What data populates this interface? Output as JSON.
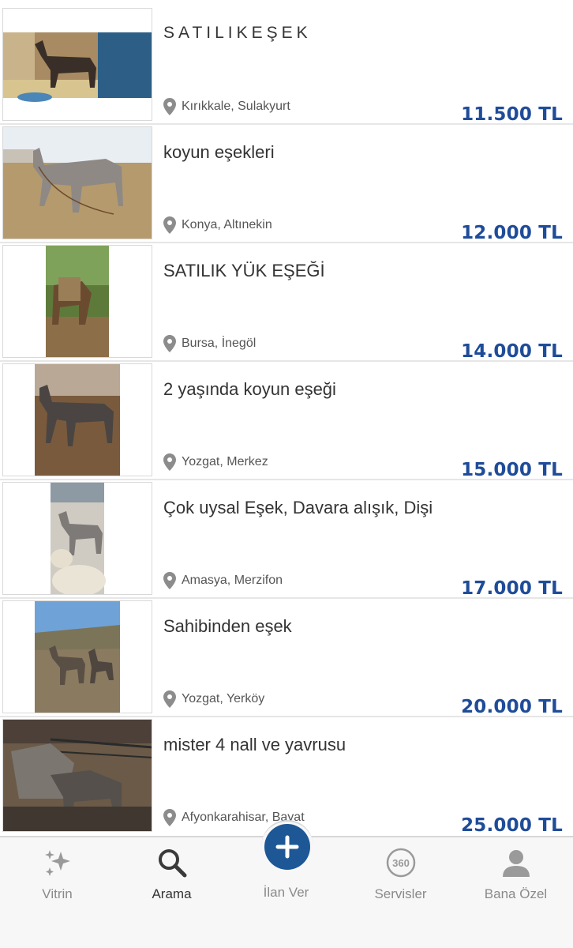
{
  "listings": [
    {
      "title": "SATILIKEŞEK",
      "location": "Kırıkkale, Sulakyurt",
      "price": "11.500 TL"
    },
    {
      "title": "koyun eşekleri",
      "location": "Konya, Altınekin",
      "price": "12.000 TL"
    },
    {
      "title": "SATILIK YÜK EŞEĞİ",
      "location": "Bursa, İnegöl",
      "price": "14.000 TL"
    },
    {
      "title": "2 yaşında koyun eşeği",
      "location": "Yozgat, Merkez",
      "price": "15.000 TL"
    },
    {
      "title": "Çok uysal Eşek, Davara alışık, Dişi",
      "location": "Amasya, Merzifon",
      "price": "17.000 TL"
    },
    {
      "title": "Sahibinden eşek",
      "location": "Yozgat, Yerköy",
      "price": "20.000 TL"
    },
    {
      "title": "mister 4 nall ve yavrusu",
      "location": "Afyonkarahisar, Bayat",
      "price": "25.000 TL"
    }
  ],
  "tabbar": {
    "vitrin": {
      "label": "Vitrin",
      "icon": "sparkle-icon"
    },
    "arama": {
      "label": "Arama",
      "icon": "search-icon"
    },
    "ilan_ver": {
      "label": "İlan Ver",
      "icon": "plus-icon"
    },
    "servisler": {
      "label": "Servisler",
      "icon": "360-icon"
    },
    "bana_ozel": {
      "label": "Bana Özel",
      "icon": "user-icon"
    }
  },
  "colors": {
    "price": "#1f4c99",
    "accent": "#1d5796",
    "tab_inactive": "#8a8a8a"
  }
}
